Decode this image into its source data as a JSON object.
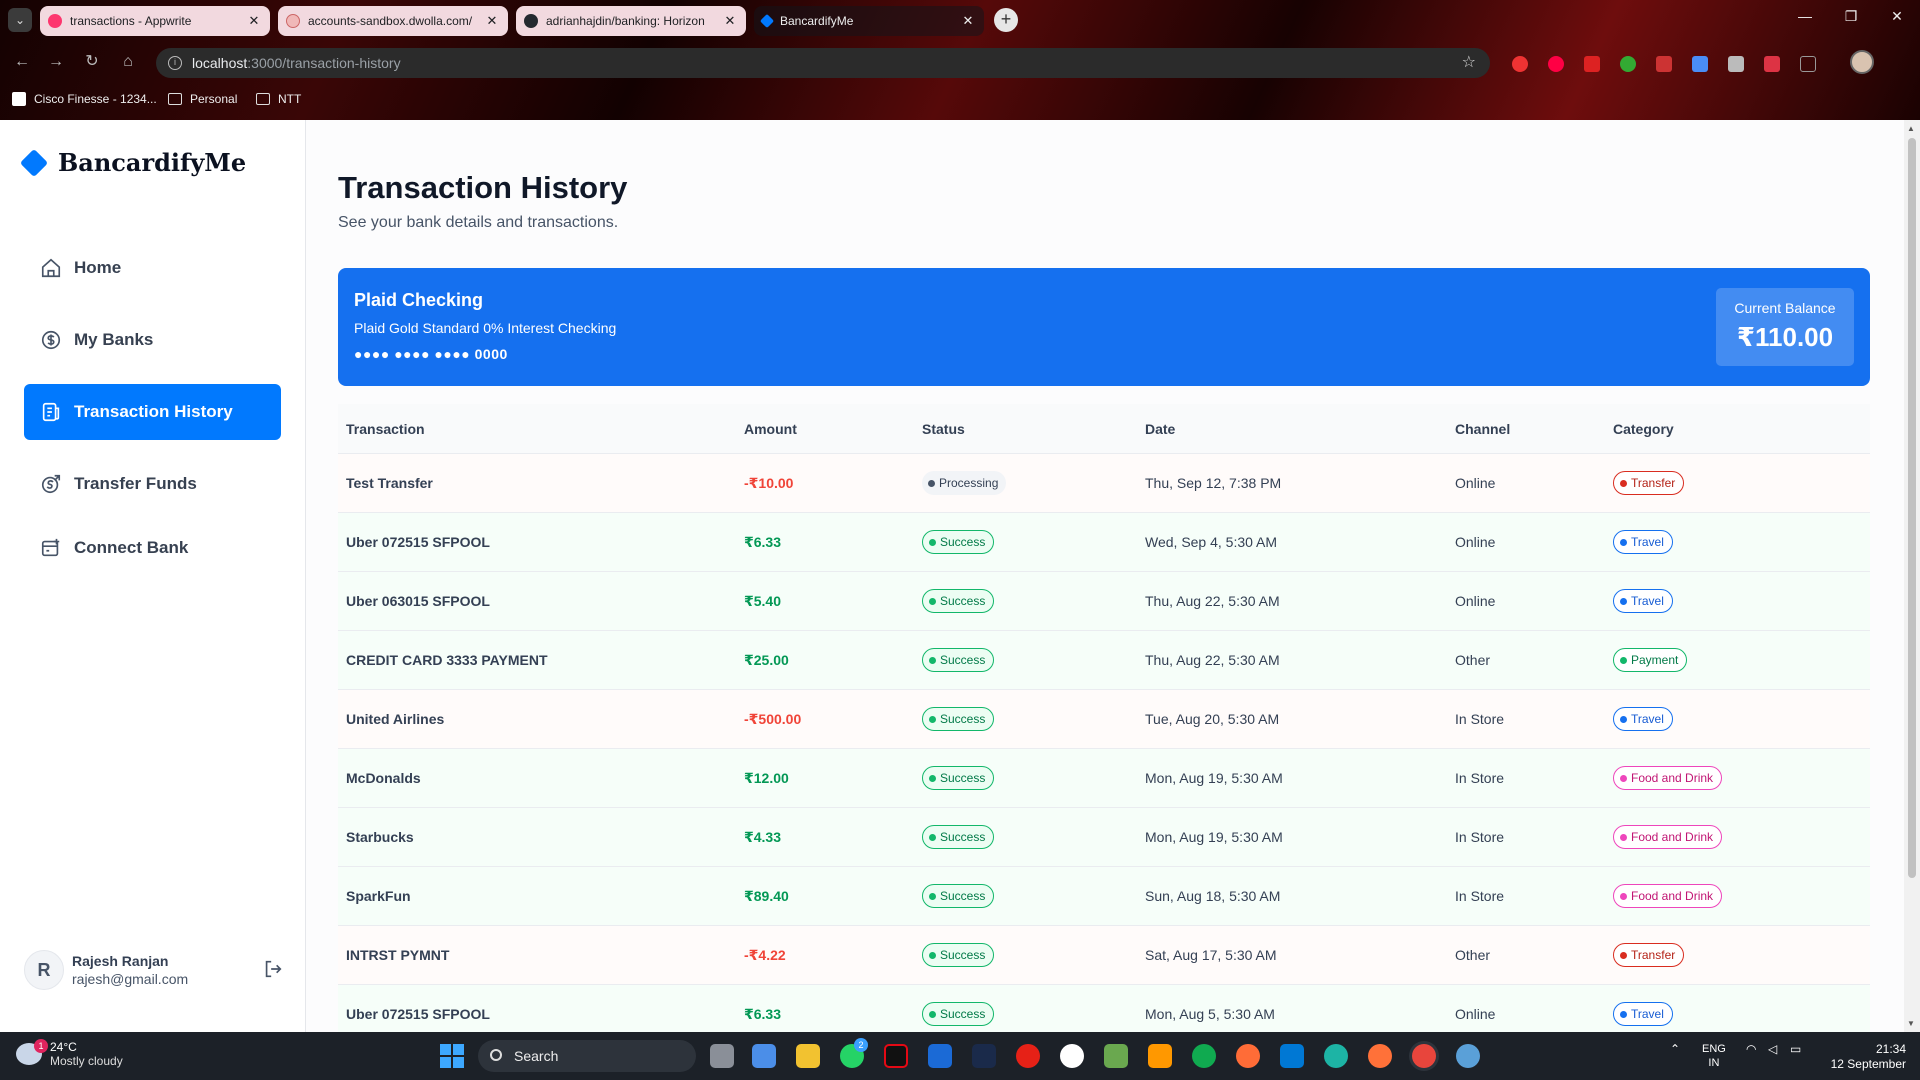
{
  "browser": {
    "tabs": [
      {
        "title": "transactions - Appwrite",
        "active": false
      },
      {
        "title": "accounts-sandbox.dwolla.com/",
        "active": false
      },
      {
        "title": "adrianhajdin/banking: Horizon",
        "active": false
      },
      {
        "title": "BancardifyMe",
        "active": true
      }
    ],
    "url_host": "localhost",
    "url_path": ":3000/transaction-history",
    "bookmarks": [
      "Cisco Finesse - 1234...",
      "Personal",
      "NTT"
    ]
  },
  "sidebar": {
    "logo": "BancardifyMe",
    "items": [
      {
        "label": "Home",
        "icon": "home-icon",
        "active": false
      },
      {
        "label": "My Banks",
        "icon": "dollar-circle-icon",
        "active": false
      },
      {
        "label": "Transaction History",
        "icon": "receipt-icon",
        "active": true
      },
      {
        "label": "Transfer Funds",
        "icon": "money-send-icon",
        "active": false
      },
      {
        "label": "Connect Bank",
        "icon": "connect-bank-icon",
        "active": false
      }
    ],
    "user": {
      "initial": "R",
      "name": "Rajesh Ranjan",
      "email": "rajesh@gmail.com"
    }
  },
  "main": {
    "title": "Transaction History",
    "subtitle": "See your bank details and transactions.",
    "account": {
      "name": "Plaid Checking",
      "official_name": "Plaid Gold Standard 0% Interest Checking",
      "mask": "●●●● ●●●● ●●●● 0000",
      "balance_label": "Current Balance",
      "balance": "₹110.00"
    },
    "table": {
      "headers": [
        "Transaction",
        "Amount",
        "Status",
        "Date",
        "Channel",
        "Category"
      ],
      "rows": [
        {
          "name": "Test Transfer",
          "amount": "-₹10.00",
          "type": "debit",
          "status": "Processing",
          "date": "Thu, Sep 12, 7:38 PM",
          "channel": "Online",
          "category": "Transfer"
        },
        {
          "name": "Uber 072515 SFPOOL",
          "amount": "₹6.33",
          "type": "credit",
          "status": "Success",
          "date": "Wed, Sep 4, 5:30 AM",
          "channel": "Online",
          "category": "Travel"
        },
        {
          "name": "Uber 063015 SFPOOL",
          "amount": "₹5.40",
          "type": "credit",
          "status": "Success",
          "date": "Thu, Aug 22, 5:30 AM",
          "channel": "Online",
          "category": "Travel"
        },
        {
          "name": "CREDIT CARD 3333 PAYMENT",
          "amount": "₹25.00",
          "type": "credit",
          "status": "Success",
          "date": "Thu, Aug 22, 5:30 AM",
          "channel": "Other",
          "category": "Payment"
        },
        {
          "name": "United Airlines",
          "amount": "-₹500.00",
          "type": "debit",
          "status": "Success",
          "date": "Tue, Aug 20, 5:30 AM",
          "channel": "In Store",
          "category": "Travel"
        },
        {
          "name": "McDonalds",
          "amount": "₹12.00",
          "type": "credit",
          "status": "Success",
          "date": "Mon, Aug 19, 5:30 AM",
          "channel": "In Store",
          "category": "Food and Drink"
        },
        {
          "name": "Starbucks",
          "amount": "₹4.33",
          "type": "credit",
          "status": "Success",
          "date": "Mon, Aug 19, 5:30 AM",
          "channel": "In Store",
          "category": "Food and Drink"
        },
        {
          "name": "SparkFun",
          "amount": "₹89.40",
          "type": "credit",
          "status": "Success",
          "date": "Sun, Aug 18, 5:30 AM",
          "channel": "In Store",
          "category": "Food and Drink"
        },
        {
          "name": "INTRST PYMNT",
          "amount": "-₹4.22",
          "type": "debit",
          "status": "Success",
          "date": "Sat, Aug 17, 5:30 AM",
          "channel": "Other",
          "category": "Transfer"
        },
        {
          "name": "Uber 072515 SFPOOL",
          "amount": "₹6.33",
          "type": "credit",
          "status": "Success",
          "date": "Mon, Aug 5, 5:30 AM",
          "channel": "Online",
          "category": "Travel"
        }
      ]
    }
  },
  "taskbar": {
    "weather_temp": "24°C",
    "weather_desc": "Mostly cloudy",
    "weather_badge": "1",
    "search": "Search",
    "whatsapp_badge": "2",
    "lang_top": "ENG",
    "lang_bottom": "IN",
    "time": "21:34",
    "date": "12 September"
  },
  "colors": {
    "accent": "#0179fe",
    "card": "#1570ef",
    "success": "#12b76a",
    "debit": "#f04438"
  }
}
